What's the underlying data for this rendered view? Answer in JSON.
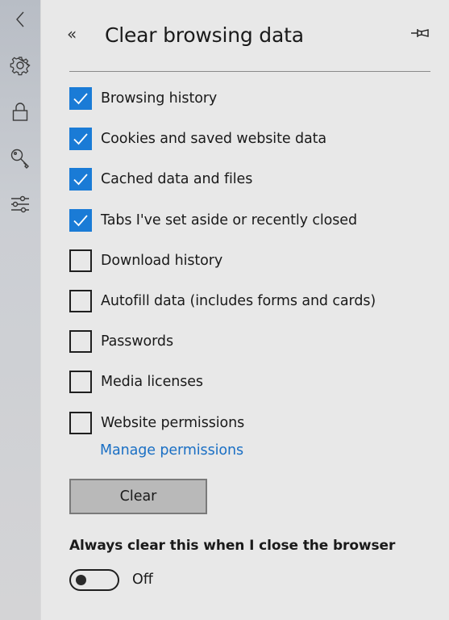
{
  "sidebar": {
    "items": [
      {
        "icon": "back-arrow-icon",
        "label": "Back"
      },
      {
        "icon": "gear-icon",
        "label": "Settings"
      },
      {
        "icon": "lock-icon",
        "label": "Privacy & security"
      },
      {
        "icon": "key-icon",
        "label": "Passwords & autofill"
      },
      {
        "icon": "sliders-icon",
        "label": "Advanced"
      }
    ]
  },
  "header": {
    "back_glyph": "«",
    "title": "Clear browsing data",
    "pin_icon": "pin-icon"
  },
  "options": [
    {
      "label": "Browsing history",
      "checked": true
    },
    {
      "label": "Cookies and saved website data",
      "checked": true
    },
    {
      "label": "Cached data and files",
      "checked": true
    },
    {
      "label": "Tabs I've set aside or recently closed",
      "checked": true
    },
    {
      "label": "Download history",
      "checked": false
    },
    {
      "label": "Autofill data (includes forms and cards)",
      "checked": false
    },
    {
      "label": "Passwords",
      "checked": false
    },
    {
      "label": "Media licenses",
      "checked": false
    },
    {
      "label": "Website permissions",
      "checked": false
    }
  ],
  "manage_link": "Manage permissions",
  "clear_button": "Clear",
  "always_clear": {
    "label": "Always clear this when I close the browser",
    "state": "Off",
    "on": false
  },
  "colors": {
    "accent": "#1a7bd6",
    "link": "#1a6fc4",
    "panel_bg": "#e8e8e8",
    "button_bg": "#b9b9b9"
  }
}
